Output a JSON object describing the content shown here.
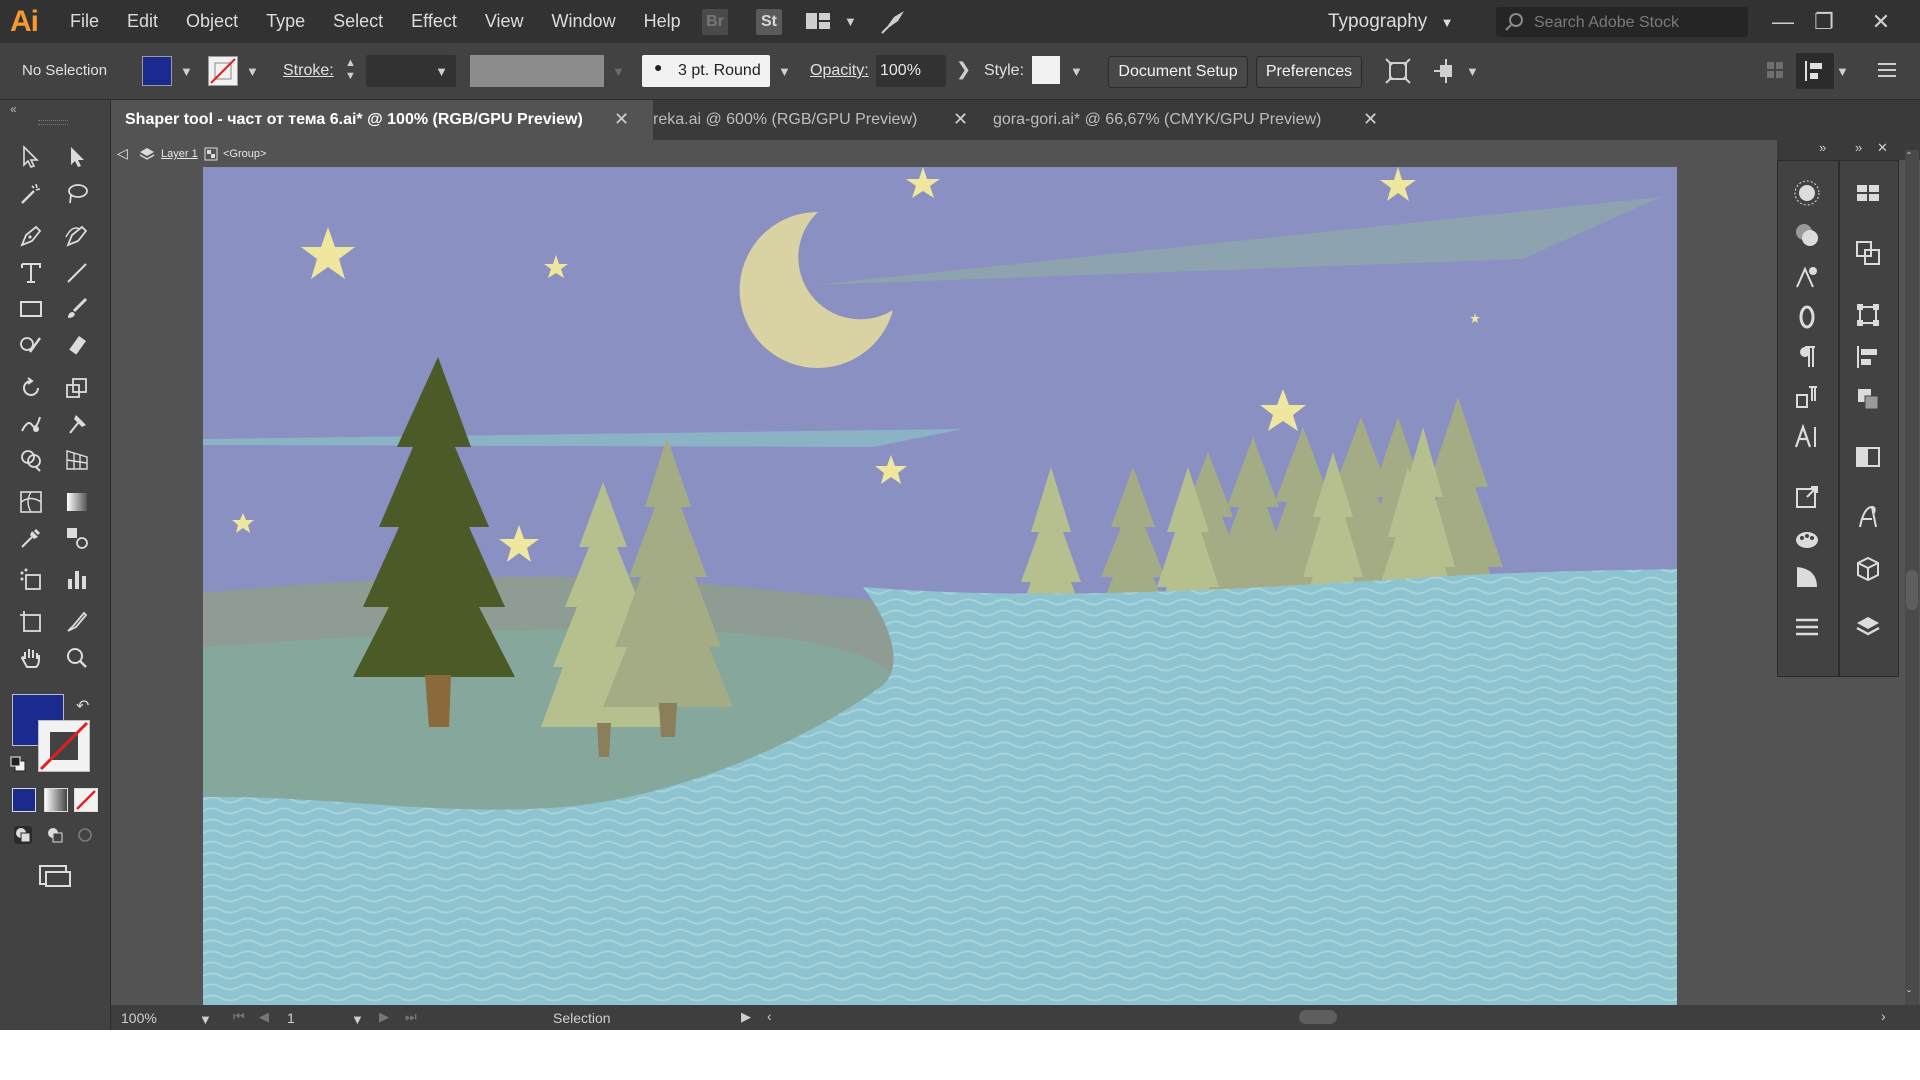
{
  "app": {
    "logo": "Ai"
  },
  "menu": [
    "File",
    "Edit",
    "Object",
    "Type",
    "Select",
    "Effect",
    "View",
    "Window",
    "Help"
  ],
  "menubar_buttons": {
    "bridge": "Br",
    "stock": "St"
  },
  "workspace": {
    "name": "Typography"
  },
  "search": {
    "placeholder": "Search Adobe Stock"
  },
  "control_bar": {
    "selection_state": "No Selection",
    "fill_color": "#1a2a8e",
    "stroke_label": "Stroke:",
    "brush_label": "3 pt. Round",
    "opacity_label": "Opacity:",
    "opacity_value": "100%",
    "style_label": "Style:",
    "document_setup": "Document Setup",
    "preferences": "Preferences"
  },
  "tabs": [
    {
      "label": "Shaper tool - част от тема 6.ai* @ 100% (RGB/GPU Preview)",
      "active": true
    },
    {
      "label": "reka.ai @ 600% (RGB/GPU Preview)",
      "active": false
    },
    {
      "label": "gora-gori.ai* @ 66,67% (CMYK/GPU Preview)",
      "active": false
    }
  ],
  "breadcrumb": {
    "layer": "Layer 1",
    "group": "<Group>"
  },
  "status": {
    "zoom": "100%",
    "artboard": "1",
    "tool": "Selection"
  },
  "colors": {
    "sky": "#8a90c2",
    "moon": "#d9d2a2",
    "star": "#f0e79e",
    "water": "#8ec4d0",
    "far_hill": "#8e9c94",
    "near_hill": "#86a89c",
    "dark_tree": "#4b5a27",
    "light_tree": "#b6c08f",
    "mid_tree": "#a3ac85",
    "trunk": "#8a6a3a",
    "fill_swatch": "#1a2a8e"
  }
}
